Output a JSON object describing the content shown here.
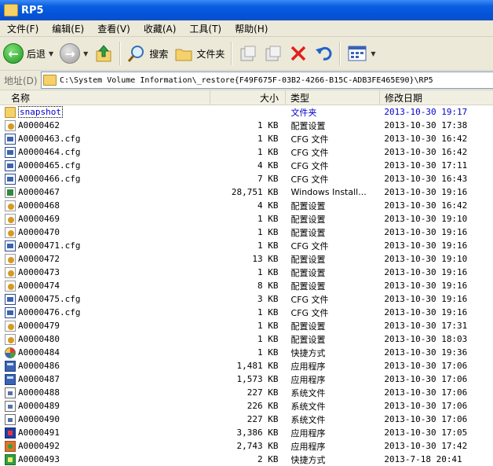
{
  "window": {
    "title": "RP5"
  },
  "menu": [
    "文件(F)",
    "编辑(E)",
    "查看(V)",
    "收藏(A)",
    "工具(T)",
    "帮助(H)"
  ],
  "toolbar": {
    "back": "后退",
    "search": "搜索",
    "folders": "文件夹"
  },
  "address": {
    "label": "地址(D)",
    "path": "C:\\System Volume Information\\_restore{F49F675F-03B2-4266-B15C-ADB3FE465E90}\\RP5"
  },
  "columns": {
    "name": "名称",
    "size": "大小",
    "type": "类型",
    "date": "修改日期"
  },
  "rows": [
    {
      "name": "snapshot",
      "size": "",
      "type": "文件夹",
      "date": "2013-10-30 19:17",
      "icon": "folder-icon"
    },
    {
      "name": "A0000462",
      "size": "1 KB",
      "type": "配置设置",
      "date": "2013-10-30 17:38",
      "icon": "gear-icon"
    },
    {
      "name": "A0000463.cfg",
      "size": "1 KB",
      "type": "CFG 文件",
      "date": "2013-10-30 16:42",
      "icon": "cfg-icon"
    },
    {
      "name": "A0000464.cfg",
      "size": "1 KB",
      "type": "CFG 文件",
      "date": "2013-10-30 16:42",
      "icon": "cfg-icon"
    },
    {
      "name": "A0000465.cfg",
      "size": "4 KB",
      "type": "CFG 文件",
      "date": "2013-10-30 17:11",
      "icon": "cfg-icon"
    },
    {
      "name": "A0000466.cfg",
      "size": "7 KB",
      "type": "CFG 文件",
      "date": "2013-10-30 16:43",
      "icon": "cfg-icon"
    },
    {
      "name": "A0000467",
      "size": "28,751 KB",
      "type": "Windows Install...",
      "date": "2013-10-30 19:16",
      "icon": "installer-icon"
    },
    {
      "name": "A0000468",
      "size": "4 KB",
      "type": "配置设置",
      "date": "2013-10-30 16:42",
      "icon": "gear-icon"
    },
    {
      "name": "A0000469",
      "size": "1 KB",
      "type": "配置设置",
      "date": "2013-10-30 19:10",
      "icon": "gear-icon"
    },
    {
      "name": "A0000470",
      "size": "1 KB",
      "type": "配置设置",
      "date": "2013-10-30 19:16",
      "icon": "gear-icon"
    },
    {
      "name": "A0000471.cfg",
      "size": "1 KB",
      "type": "CFG 文件",
      "date": "2013-10-30 19:16",
      "icon": "cfg-icon"
    },
    {
      "name": "A0000472",
      "size": "13 KB",
      "type": "配置设置",
      "date": "2013-10-30 19:10",
      "icon": "gear-icon"
    },
    {
      "name": "A0000473",
      "size": "1 KB",
      "type": "配置设置",
      "date": "2013-10-30 19:16",
      "icon": "gear-icon"
    },
    {
      "name": "A0000474",
      "size": "8 KB",
      "type": "配置设置",
      "date": "2013-10-30 19:16",
      "icon": "gear-icon"
    },
    {
      "name": "A0000475.cfg",
      "size": "3 KB",
      "type": "CFG 文件",
      "date": "2013-10-30 19:16",
      "icon": "cfg-icon"
    },
    {
      "name": "A0000476.cfg",
      "size": "1 KB",
      "type": "CFG 文件",
      "date": "2013-10-30 19:16",
      "icon": "cfg-icon"
    },
    {
      "name": "A0000479",
      "size": "1 KB",
      "type": "配置设置",
      "date": "2013-10-30 17:31",
      "icon": "gear-icon"
    },
    {
      "name": "A0000480",
      "size": "1 KB",
      "type": "配置设置",
      "date": "2013-10-30 18:03",
      "icon": "gear-icon"
    },
    {
      "name": "A0000484",
      "size": "1 KB",
      "type": "快捷方式",
      "date": "2013-10-30 19:36",
      "icon": "shortcut-icon"
    },
    {
      "name": "A0000486",
      "size": "1,481 KB",
      "type": "应用程序",
      "date": "2013-10-30 17:06",
      "icon": "application-icon"
    },
    {
      "name": "A0000487",
      "size": "1,573 KB",
      "type": "应用程序",
      "date": "2013-10-30 17:06",
      "icon": "application-icon"
    },
    {
      "name": "A0000488",
      "size": "227 KB",
      "type": "系统文件",
      "date": "2013-10-30 17:06",
      "icon": "system-file-icon"
    },
    {
      "name": "A0000489",
      "size": "226 KB",
      "type": "系统文件",
      "date": "2013-10-30 17:06",
      "icon": "system-file-icon"
    },
    {
      "name": "A0000490",
      "size": "227 KB",
      "type": "系统文件",
      "date": "2013-10-30 17:06",
      "icon": "system-file-icon"
    },
    {
      "name": "A0000491",
      "size": "3,386 KB",
      "type": "应用程序",
      "date": "2013-10-30 17:05",
      "icon": "setup-icon"
    },
    {
      "name": "A0000492",
      "size": "2,743 KB",
      "type": "应用程序",
      "date": "2013-10-30 17:42",
      "icon": "app-shield-icon"
    },
    {
      "name": "A0000493",
      "size": "2 KB",
      "type": "快捷方式",
      "date": "2013-7-18 20:41",
      "icon": "shortcut-green-icon"
    }
  ]
}
